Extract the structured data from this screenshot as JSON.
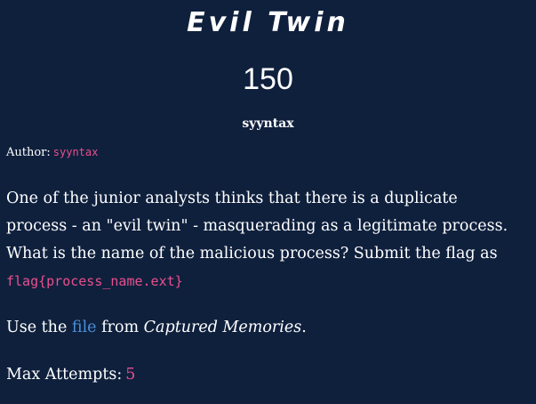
{
  "challenge": {
    "title": "Evil Twin",
    "points": "150",
    "solver": "syyntax",
    "author_label": "Author:",
    "author_name": "syyntax",
    "description_text": "One of the junior analysts thinks that there is a duplicate process - an \"evil twin\" - masquerading as a legitimate process. What is the name of the malicious process? Submit the flag as",
    "flag_format": "flag{process_name.ext}",
    "use_prefix": "Use the",
    "use_link": "file",
    "use_middle": "from",
    "use_source": "Captured Memories",
    "use_suffix": ".",
    "attempts_label": "Max Attempts:",
    "attempts_value": "5"
  },
  "colors": {
    "background": "#0f203d",
    "accent_pink": "#e8508d",
    "link_blue": "#4a90d9",
    "text": "#ffffff"
  }
}
